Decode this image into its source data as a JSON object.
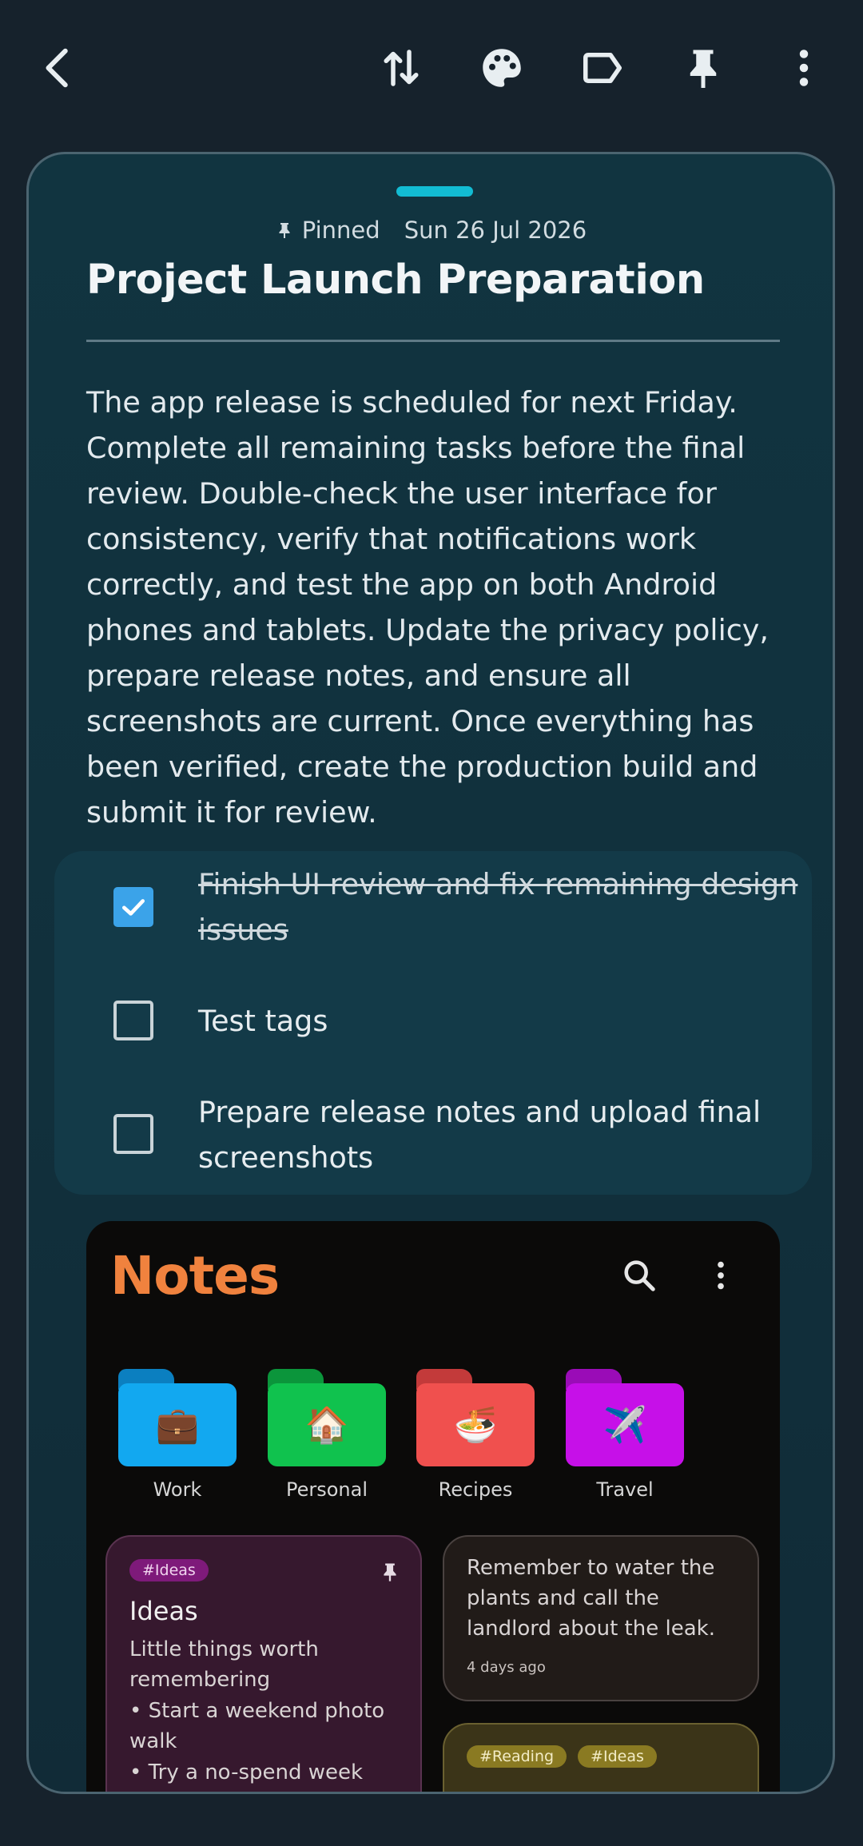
{
  "toolbar": {
    "back": "back-arrow-icon",
    "icons": [
      "sort-arrows-icon",
      "palette-icon",
      "label-icon",
      "pin-icon",
      "more-vert-icon"
    ]
  },
  "note": {
    "pinned_label": "Pinned",
    "date": "Sun 26 Jul 2026",
    "title": "Project Launch Preparation",
    "body": "The app release is scheduled for next Friday. Complete all remaining tasks before the final review. Double-check the user interface for consistency, verify that notifications work correctly, and test the app on both Android phones and tablets. Update the privacy policy, prepare release notes, and ensure all screenshots are current. Once everything has been verified, create the production build and submit it for review.",
    "checklist": [
      {
        "text": "Finish UI review and fix remaining design issues",
        "checked": true
      },
      {
        "text": "Test tags",
        "checked": false
      },
      {
        "text": "Prepare release notes and upload final screenshots",
        "checked": false
      }
    ]
  },
  "screenshot": {
    "app_name": "Notes",
    "folders": [
      {
        "label": "Work",
        "emoji": "💼",
        "color": "#12a8f0"
      },
      {
        "label": "Personal",
        "emoji": "🏠",
        "color": "#10c24e"
      },
      {
        "label": "Recipes",
        "emoji": "🍜",
        "color": "#f0504e"
      },
      {
        "label": "Travel",
        "emoji": "✈️",
        "color": "#c610e8"
      }
    ],
    "cards": {
      "ideas": {
        "tag": "#Ideas",
        "title": "Ideas",
        "line1": "Little things worth remembering",
        "line2": "• Start a weekend photo walk",
        "line3": "• Try a no-spend week"
      },
      "reminder": {
        "text": "Remember to water the plants and call the landlord about the leak.",
        "time": "4 days ago"
      },
      "reading": {
        "tag1": "#Reading",
        "tag2": "#Ideas"
      }
    }
  },
  "colors": {
    "background": "#16222c",
    "accent": "#12bcd3",
    "checkbox": "#3ba3e9",
    "logo": "#f0823e"
  }
}
